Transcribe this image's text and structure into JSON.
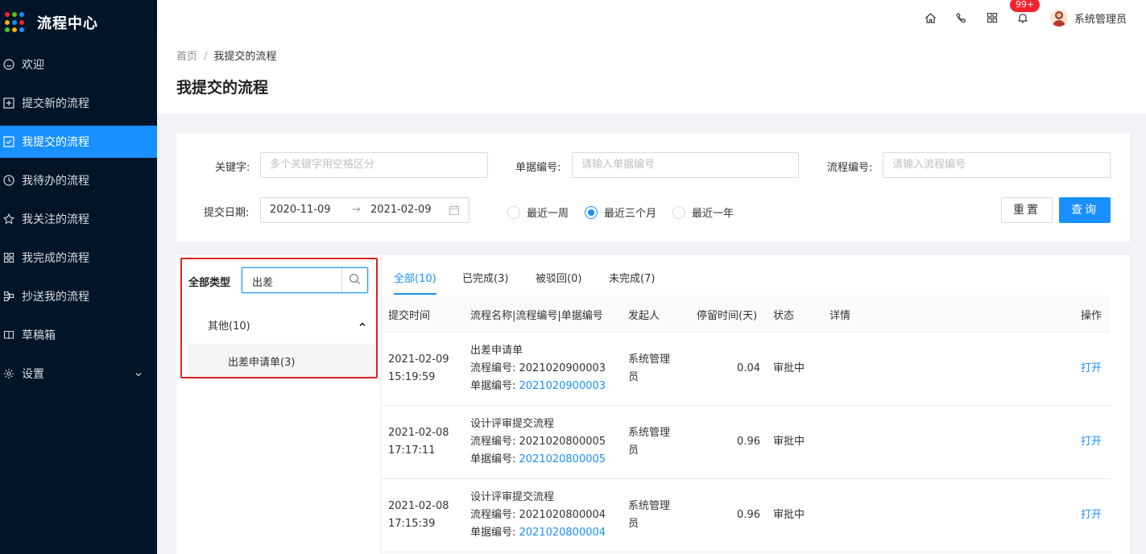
{
  "app": {
    "title": "流程中心",
    "logo_colors": [
      "#f5222d",
      "#52c41a",
      "#1890ff",
      "#faad14",
      "#1890ff",
      "#f5222d",
      "#52c41a",
      "#faad14",
      "#1890ff"
    ]
  },
  "sidebar": {
    "items": [
      {
        "label": "欢迎",
        "icon": "smile-icon"
      },
      {
        "label": "提交新的流程",
        "icon": "plus-square-icon"
      },
      {
        "label": "我提交的流程",
        "icon": "check-square-icon"
      },
      {
        "label": "我待办的流程",
        "icon": "clock-icon"
      },
      {
        "label": "我关注的流程",
        "icon": "star-icon"
      },
      {
        "label": "我完成的流程",
        "icon": "appstore-icon"
      },
      {
        "label": "抄送我的流程",
        "icon": "cluster-icon"
      },
      {
        "label": "草稿箱",
        "icon": "book-icon"
      },
      {
        "label": "设置",
        "icon": "setting-icon"
      }
    ],
    "active_index": 2,
    "accent": "#1890ff",
    "background": "#001529"
  },
  "header": {
    "badge": "99+",
    "user_name": "系统管理员"
  },
  "page": {
    "breadcrumb_home": "首页",
    "breadcrumb_sep": "/",
    "breadcrumb_current": "我提交的流程",
    "title": "我提交的流程"
  },
  "search": {
    "keyword_label": "关键字:",
    "keyword_placeholder": "多个关键字用空格区分",
    "doc_label": "单据编号:",
    "doc_placeholder": "请输入单据编号",
    "flow_label": "流程编号:",
    "flow_placeholder": "请输入流程编号",
    "date_label": "提交日期:",
    "date_start": "2020-11-09",
    "date_arrow": "→",
    "date_end": "2021-02-09",
    "radios": [
      "最近一周",
      "最近三个月",
      "最近一年"
    ],
    "radio_selected": 1,
    "reset_label": "重置",
    "query_label": "查询"
  },
  "types": {
    "label": "全部类型",
    "search_value": "出差",
    "group": "其他(10)",
    "child": "出差申请单(3)"
  },
  "tabs": [
    "全部(10)",
    "已完成(3)",
    "被驳回(0)",
    "未完成(7)"
  ],
  "table": {
    "headers": [
      "提交时间",
      "流程名称|流程编号|单据编号",
      "发起人",
      "停留时间(天)",
      "状态",
      "详情",
      "操作"
    ],
    "rows": [
      {
        "date": "2021-02-09",
        "time": "15:19:59",
        "name": "出差申请单",
        "flow_no": "流程编号: 2021020900003",
        "doc_prefix": "单据编号: ",
        "doc_no": "2021020900003",
        "initiator_1": "系统管理",
        "initiator_2": "员",
        "stay": "0.04",
        "status": "审批中",
        "action": "打开"
      },
      {
        "date": "2021-02-08",
        "time": "17:17:11",
        "name": "设计评审提交流程",
        "flow_no": "流程编号: 2021020800005",
        "doc_prefix": "单据编号: ",
        "doc_no": "2021020800005",
        "initiator_1": "系统管理",
        "initiator_2": "员",
        "stay": "0.96",
        "status": "审批中",
        "action": "打开"
      },
      {
        "date": "2021-02-08",
        "time": "17:15:39",
        "name": "设计评审提交流程",
        "flow_no": "流程编号: 2021020800004",
        "doc_prefix": "单据编号: ",
        "doc_no": "2021020800004",
        "initiator_1": "系统管理",
        "initiator_2": "员",
        "stay": "0.96",
        "status": "审批中",
        "action": "打开"
      }
    ]
  }
}
